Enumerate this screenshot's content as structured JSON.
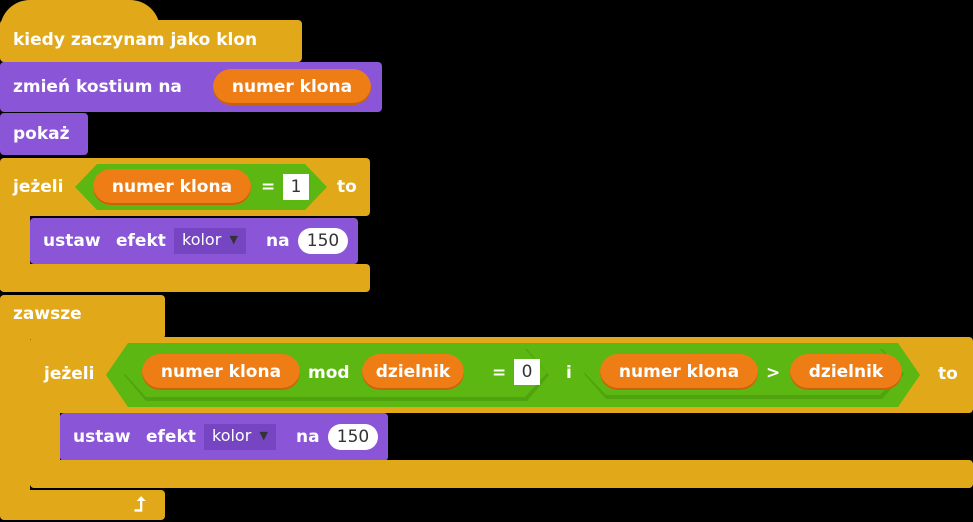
{
  "script": {
    "hat_label": "kiedy zaczynam jako klon",
    "switch_costume": {
      "label": "zmień kostium na",
      "reporter": "numer klona"
    },
    "show_label": "pokaż",
    "if1": {
      "label": "jeżeli",
      "then": "to",
      "reporter": "numer klona",
      "op": "=",
      "value": "1",
      "body": {
        "label1": "ustaw",
        "label2": "efekt",
        "effect": "kolor",
        "label3": "na",
        "value": "150"
      }
    },
    "forever_label": "zawsze",
    "if2": {
      "label": "jeżeli",
      "then": "to",
      "reporter1": "numer klona",
      "mod": "mod",
      "reporter2": "dzielnik",
      "eq": "=",
      "value": "0",
      "and": "i",
      "reporter3": "numer klona",
      "gt": ">",
      "reporter4": "dzielnik",
      "body": {
        "label1": "ustaw",
        "label2": "efekt",
        "effect": "kolor",
        "label3": "na",
        "value": "150"
      }
    }
  },
  "colors": {
    "control": "#e1a91a",
    "looks": "#8a55d7",
    "operators": "#5cb712",
    "data": "#ee7d16"
  }
}
